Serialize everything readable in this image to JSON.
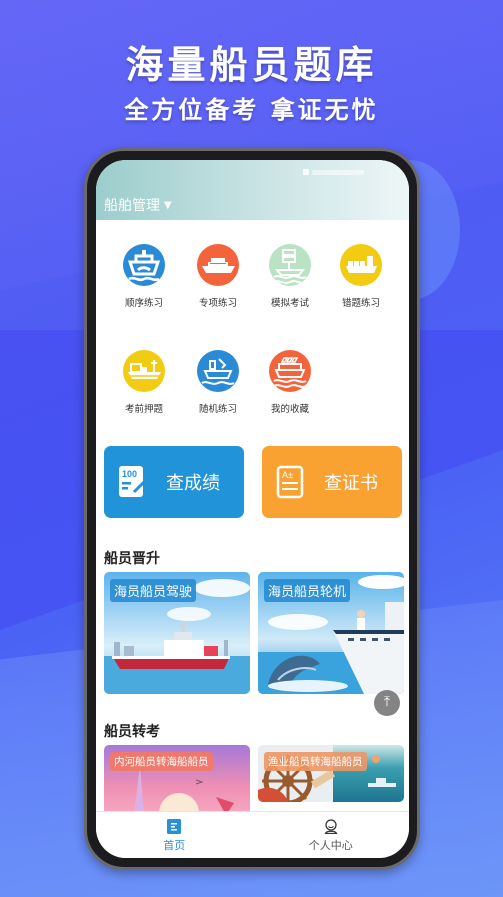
{
  "promo": {
    "title": "海量船员题库",
    "subtitle": "全方位备考 拿证无忧"
  },
  "header": {
    "title": "船舶管理",
    "dropdown_icon": "caret-down-icon"
  },
  "grid": {
    "items": [
      {
        "label": "顺序练习",
        "icon": "ferry-icon",
        "color": "#2a8ad6"
      },
      {
        "label": "专项练习",
        "icon": "cruise-ship-icon",
        "color": "#f4643c"
      },
      {
        "label": "模拟考试",
        "icon": "sailboat-icon",
        "color": "#b9e3c2"
      },
      {
        "label": "错题练习",
        "icon": "cargo-ship-icon",
        "color": "#f1cc12"
      },
      {
        "label": "考前押题",
        "icon": "container-ship-icon",
        "color": "#f1cc12"
      },
      {
        "label": "随机练习",
        "icon": "tugboat-icon",
        "color": "#2a8ad6"
      },
      {
        "label": "我的收藏",
        "icon": "passenger-ship-icon",
        "color": "#f4643c"
      }
    ]
  },
  "actions": {
    "scores": {
      "label": "查成绩",
      "icon": "score-sheet-icon",
      "color": "#2193d8"
    },
    "certificate": {
      "label": "查证书",
      "icon": "certificate-icon",
      "color": "#f9a232"
    }
  },
  "sections": [
    {
      "title": "船员晋升",
      "cards": [
        {
          "label": "海员船员驾驶"
        },
        {
          "label": "海员船员轮机"
        }
      ]
    },
    {
      "title": "船员转考",
      "cards": [
        {
          "label": "内河船员转海船船员"
        },
        {
          "label": "渔业船员转海船船员"
        }
      ]
    }
  ],
  "back_to_top": {
    "icon": "back-to-top-icon",
    "glyph": "⤒"
  },
  "tabbar": {
    "tabs": [
      {
        "label": "首页",
        "active": true
      },
      {
        "label": "个人中心",
        "active": false
      }
    ]
  },
  "colors": {
    "accent": "#2a8fd3",
    "background": "#4f5cf3"
  }
}
